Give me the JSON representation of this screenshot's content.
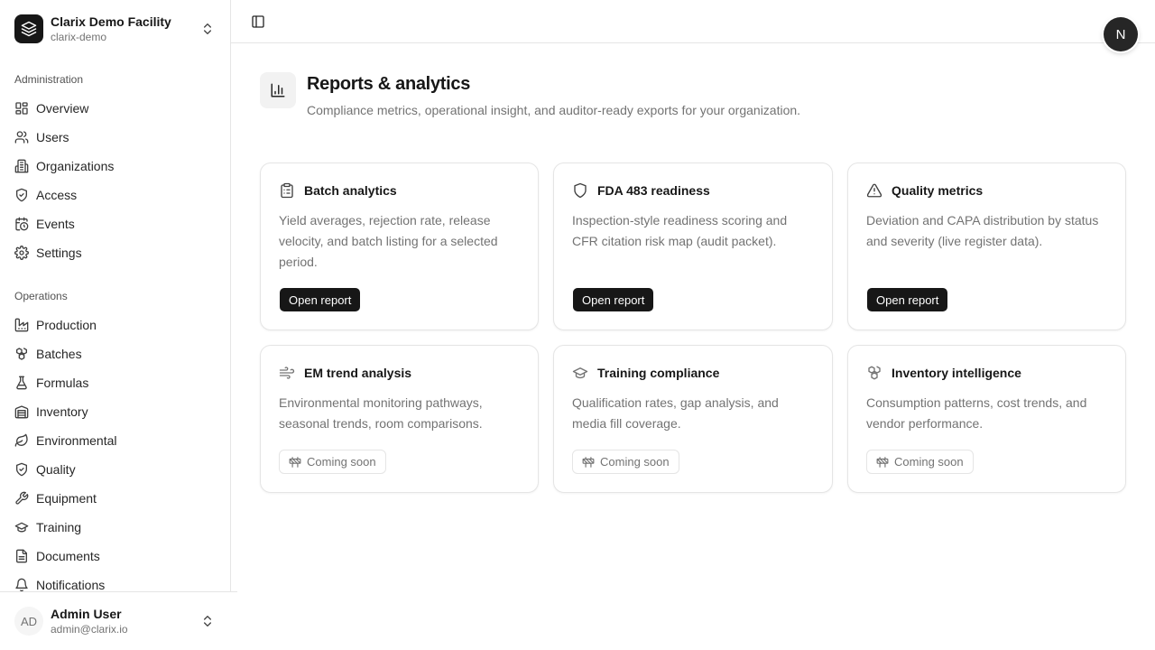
{
  "org": {
    "name": "Clarix Demo Facility",
    "slug": "clarix-demo"
  },
  "sidebar": {
    "admin_label": "Administration",
    "admin_items": [
      {
        "label": "Overview",
        "icon": "dashboard-icon"
      },
      {
        "label": "Users",
        "icon": "users-icon"
      },
      {
        "label": "Organizations",
        "icon": "building-icon"
      },
      {
        "label": "Access",
        "icon": "shield-check-icon"
      },
      {
        "label": "Events",
        "icon": "calendar-clock-icon"
      },
      {
        "label": "Settings",
        "icon": "gear-icon"
      }
    ],
    "ops_label": "Operations",
    "ops_items": [
      {
        "label": "Production",
        "icon": "factory-icon"
      },
      {
        "label": "Batches",
        "icon": "boxes-icon"
      },
      {
        "label": "Formulas",
        "icon": "flask-icon"
      },
      {
        "label": "Inventory",
        "icon": "warehouse-icon"
      },
      {
        "label": "Environmental",
        "icon": "leaf-icon"
      },
      {
        "label": "Quality",
        "icon": "shield-check-icon"
      },
      {
        "label": "Equipment",
        "icon": "wrench-icon"
      },
      {
        "label": "Training",
        "icon": "graduation-cap-icon"
      },
      {
        "label": "Documents",
        "icon": "file-icon"
      },
      {
        "label": "Notifications",
        "icon": "bell-icon"
      }
    ]
  },
  "user": {
    "initials": "AD",
    "name": "Admin User",
    "email": "admin@clarix.io"
  },
  "header": {
    "avatar_initial": "N"
  },
  "page": {
    "title": "Reports & analytics",
    "subtitle": "Compliance metrics, operational insight, and auditor-ready exports for your organization."
  },
  "cards": [
    {
      "title": "Batch analytics",
      "icon": "clipboard-list-icon",
      "description": "Yield averages, rejection rate, release velocity, and batch listing for a selected period.",
      "action": "Open report"
    },
    {
      "title": "FDA 483 readiness",
      "icon": "shield-icon",
      "description": "Inspection-style readiness scoring and CFR citation risk map (audit packet).",
      "action": "Open report"
    },
    {
      "title": "Quality metrics",
      "icon": "warning-triangle-icon",
      "description": "Deviation and CAPA distribution by status and severity (live register data).",
      "action": "Open report"
    },
    {
      "title": "EM trend analysis",
      "icon": "wind-icon",
      "description": "Environmental monitoring pathways, seasonal trends, room comparisons.",
      "status": "Coming soon"
    },
    {
      "title": "Training compliance",
      "icon": "graduation-cap-icon",
      "description": "Qualification rates, gap analysis, and media fill coverage.",
      "status": "Coming soon"
    },
    {
      "title": "Inventory intelligence",
      "icon": "boxes-icon",
      "description": "Consumption patterns, cost trends, and vendor performance.",
      "status": "Coming soon"
    }
  ],
  "colors": {
    "primary": "#171717",
    "muted_text": "#737373",
    "border": "#e5e5e5"
  }
}
